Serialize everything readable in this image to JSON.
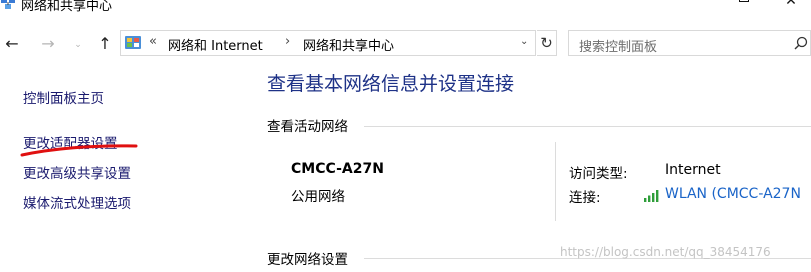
{
  "window": {
    "title": "网络和共享中心",
    "min_glyph": "",
    "close_glyph": "✕"
  },
  "nav": {
    "back": "←",
    "forward": "→",
    "recent": "⌄",
    "up": "↑"
  },
  "address": {
    "more": "«",
    "crumbs": [
      "网络和 Internet",
      "网络和共享中心"
    ],
    "separator": "›",
    "dropdown": "⌄",
    "refresh": "↻"
  },
  "search": {
    "placeholder": "搜索控制面板"
  },
  "left_pane": {
    "links": [
      "控制面板主页",
      "更改适配器设置",
      "更改高级共享设置",
      "媒体流式处理选项"
    ],
    "annotation_color": "#e01010"
  },
  "main": {
    "title": "查看基本网络信息并设置连接",
    "active_networks_heading": "查看活动网络",
    "network": {
      "name": "CMCC-A27N",
      "type": "公用网络",
      "access_type_label": "访问类型:",
      "access_type_value": "Internet",
      "connections_label": "连接:",
      "connections_value": "WLAN (CMCC-A27N"
    },
    "change_settings_heading": "更改网络设置"
  },
  "watermark": "https://blog.csdn.net/qq_38454176",
  "colors": {
    "title_blue": "#1e3287",
    "link_blue": "#1a64c8",
    "wifi_green": "#2f9e3a"
  },
  "icons": [
    "network-app-icon",
    "control-panel-icon",
    "search-icon",
    "wifi-signal-icon",
    "refresh-icon"
  ]
}
